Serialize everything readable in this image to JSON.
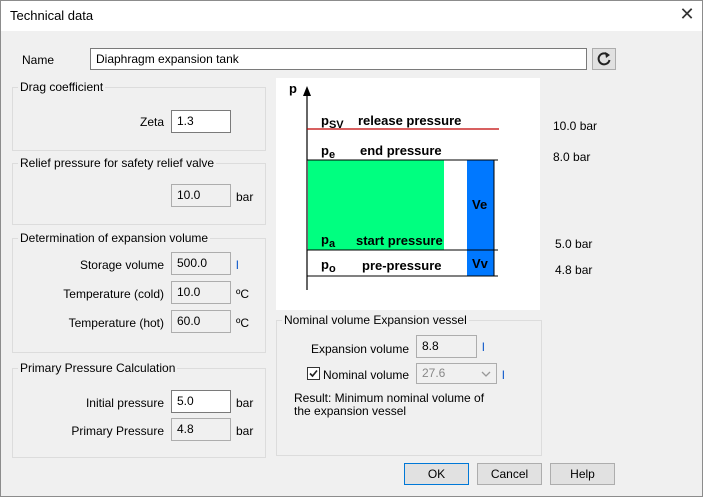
{
  "window": {
    "title": "Technical data"
  },
  "name_field": {
    "label": "Name",
    "value": "Diaphragm expansion tank"
  },
  "drag": {
    "group_label": "Drag coefficient",
    "zeta_label": "Zeta",
    "zeta_value": "1.3"
  },
  "relief": {
    "group_label": "Relief pressure for safety relief valve",
    "value": "10.0",
    "unit": "bar"
  },
  "expansion": {
    "group_label": "Determination of expansion volume",
    "storage_label": "Storage volume",
    "storage_value": "500.0",
    "storage_unit": "l",
    "cold_label": "Temperature (cold)",
    "cold_value": "10.0",
    "cold_unit": "ºC",
    "hot_label": "Temperature (hot)",
    "hot_value": "60.0",
    "hot_unit": "ºC"
  },
  "primary": {
    "group_label": "Primary Pressure Calculation",
    "initial_label": "Initial pressure",
    "initial_value": "5.0",
    "initial_unit": "bar",
    "primary_label": "Primary Pressure",
    "primary_value": "4.8",
    "primary_unit": "bar"
  },
  "diagram": {
    "axis_label": "p",
    "psv_sym": "p",
    "psv_sub": "SV",
    "psv_text": "release pressure",
    "pe_sym": "p",
    "pe_sub": "e",
    "pe_text": "end pressure",
    "pa_sym": "p",
    "pa_sub": "a",
    "pa_text": "start pressure",
    "po_sym": "p",
    "po_sub": "o",
    "po_text": "pre-pressure",
    "ve_label": "Ve",
    "vv_label": "Vv",
    "colors": {
      "water": "#00ff80",
      "vessel": "#0078ff",
      "release_line": "#c00000"
    }
  },
  "pressures": {
    "release": "10.0 bar",
    "end": "8.0 bar",
    "start": "5.0 bar",
    "pre": "4.8 bar"
  },
  "nominal": {
    "group_label": "Nominal volume Expansion vessel",
    "expansion_label": "Expansion volume",
    "expansion_value": "8.8",
    "expansion_unit": "l",
    "nominal_label": "Nominal volume",
    "nominal_checked": true,
    "nominal_value": "27.6",
    "nominal_unit": "l",
    "result_text": "Result: Minimum nominal volume of the expansion vessel"
  },
  "buttons": {
    "ok": "OK",
    "cancel": "Cancel",
    "help": "Help"
  },
  "icons": {
    "refresh": "refresh-icon",
    "close": "close-icon",
    "dropdown": "chevron-down-icon"
  }
}
